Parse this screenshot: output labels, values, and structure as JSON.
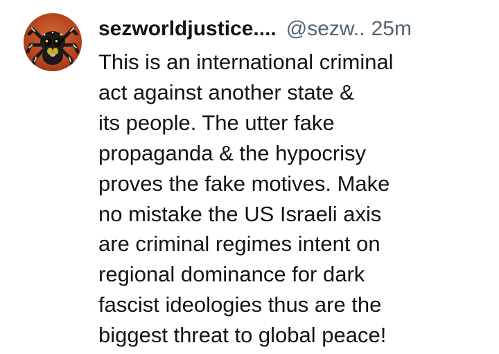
{
  "post": {
    "avatar": {
      "icon": "jumping-spider-avatar-icon",
      "colors": {
        "background": "#c4522a",
        "spider": "#1b1a18",
        "highlight": "#e7d238"
      }
    },
    "display_name": "sezworldjustice....",
    "handle": "@sezw..",
    "timestamp": "25m",
    "body": "This is an international criminal\nact against another state &\nits people. The utter fake\npropaganda & the hypocrisy\nproves the fake motives. Make\nno mistake the US Israeli axis\nare criminal regimes intent on\nregional dominance for dark\nfascist ideologies thus are the\nbiggest threat to global peace!"
  }
}
